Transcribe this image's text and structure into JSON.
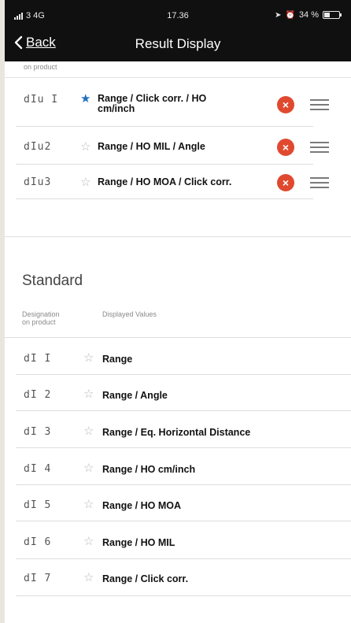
{
  "status": {
    "carrier": "3 4G",
    "time": "17.36",
    "battery": "34 %",
    "battery_level": 0.34
  },
  "nav": {
    "back_label": "Back",
    "title": "Result Display"
  },
  "user_section": {
    "partial_header": "on product",
    "rows": [
      {
        "code": "dIu I",
        "favorite": true,
        "value_line1": "Range / Click corr. / HO",
        "value_line2": "cm/inch"
      },
      {
        "code": "dIu2",
        "favorite": false,
        "value_line1": "Range / HO MIL / Angle",
        "value_line2": ""
      },
      {
        "code": "dIu3",
        "favorite": false,
        "value_line1": "Range / HO MOA / Click corr.",
        "value_line2": ""
      }
    ]
  },
  "standard_section": {
    "title": "Standard",
    "col_designation": "Designation",
    "col_designation_2": "on product",
    "col_values": "Displayed Values",
    "rows": [
      {
        "code": "dI  I",
        "value": "Range"
      },
      {
        "code": "dI 2",
        "value": "Range / Angle"
      },
      {
        "code": "dI 3",
        "value": "Range / Eq. Horizontal Distance"
      },
      {
        "code": "dI 4",
        "value": "Range / HO cm/inch"
      },
      {
        "code": "dI 5",
        "value": "Range / HO MOA"
      },
      {
        "code": "dI 6",
        "value": "Range / HO MIL"
      },
      {
        "code": "dI 7",
        "value": "Range / Click corr."
      }
    ]
  },
  "colors": {
    "header_bg": "#101010",
    "favorite_star": "#1f6fc1",
    "delete": "#e0492f"
  },
  "icons": {
    "favorite": "star-filled-icon",
    "not_favorite": "star-outline-icon",
    "delete": "delete-icon",
    "reorder": "reorder-handle-icon",
    "back": "chevron-left-icon"
  }
}
